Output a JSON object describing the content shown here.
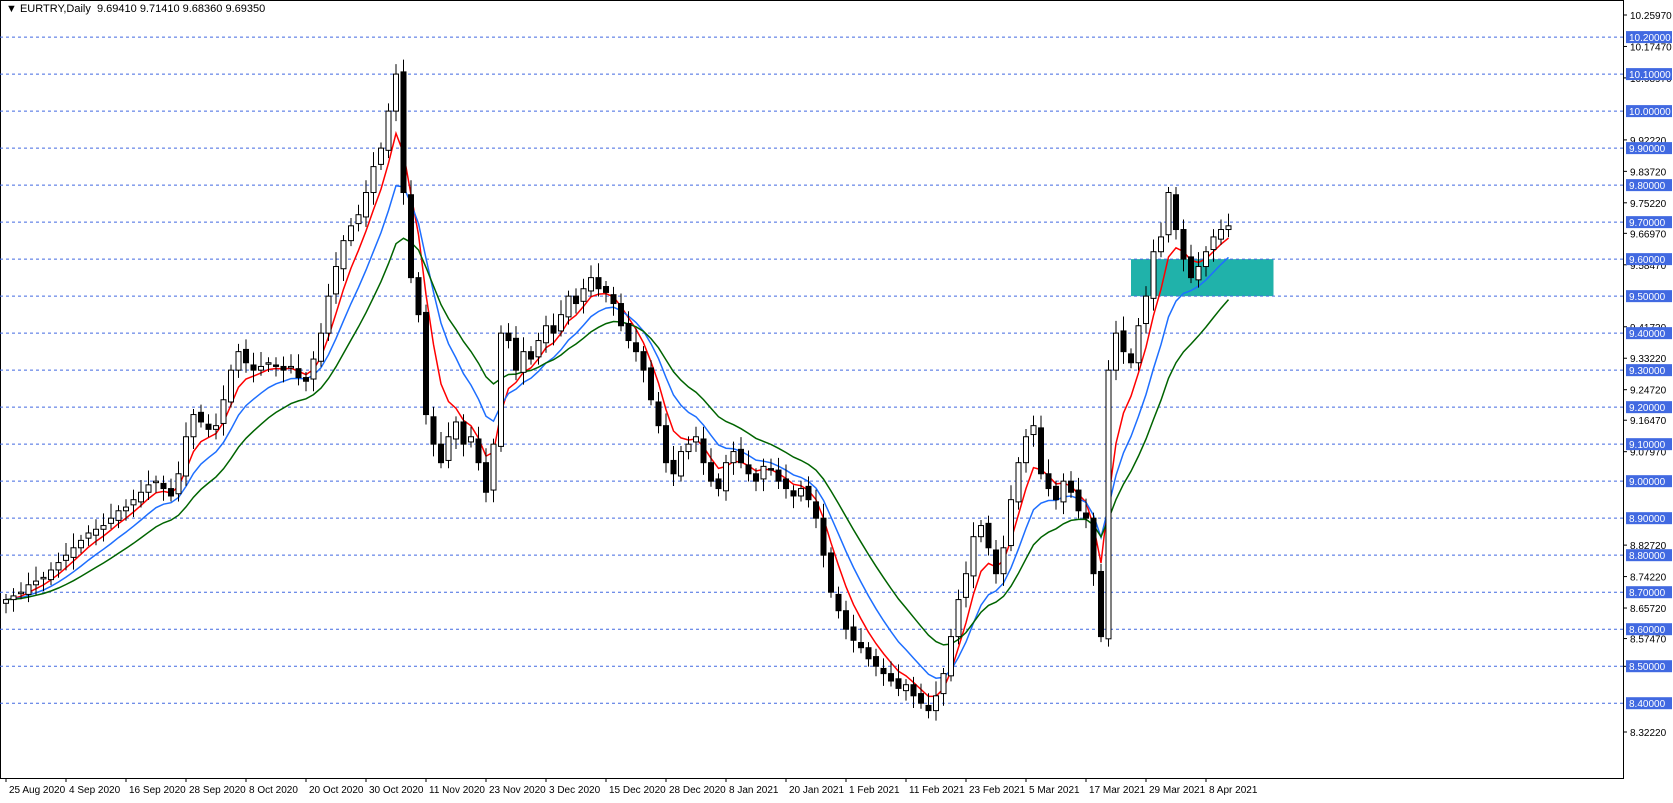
{
  "header": {
    "marker": "▼",
    "symbol": "EURTRY,Daily",
    "ohlc": "9.69410 9.71410 9.68360 9.69350"
  },
  "chart_data": {
    "type": "candlestick",
    "symbol": "EURTRY",
    "timeframe": "Daily",
    "ylim": [
      8.3222,
      10.2597
    ],
    "price_axis_ticks": [
      "10.25970",
      "10.17470",
      "10.08970",
      "9.92220",
      "9.83720",
      "9.75220",
      "9.66970",
      "9.58470",
      "9.41720",
      "9.33220",
      "9.24720",
      "9.16470",
      "9.07970",
      "8.82720",
      "8.74220",
      "8.65720",
      "8.57470",
      "8.49970",
      "8.32220"
    ],
    "grid_levels": [
      10.2,
      10.1,
      10.0,
      9.9,
      9.8,
      9.7,
      9.6,
      9.5,
      9.4,
      9.3,
      9.2,
      9.1,
      9.0,
      8.9,
      8.8,
      8.7,
      8.6,
      8.5,
      8.4
    ],
    "level_labels": [
      "10.20000",
      "10.10000",
      "10.00000",
      "9.90000",
      "9.80000",
      "9.70000",
      "9.60000",
      "9.50000",
      "9.40000",
      "9.30000",
      "9.20000",
      "9.10000",
      "9.00000",
      "8.90000",
      "8.80000",
      "8.70000",
      "8.60000",
      "8.50000",
      "8.40000"
    ],
    "date_labels": [
      "25 Aug 2020",
      "4 Sep 2020",
      "16 Sep 2020",
      "28 Sep 2020",
      "8 Oct 2020",
      "20 Oct 2020",
      "30 Oct 2020",
      "11 Nov 2020",
      "23 Nov 2020",
      "3 Dec 2020",
      "15 Dec 2020",
      "28 Dec 2020",
      "8 Jan 2021",
      "20 Jan 2021",
      "1 Feb 2021",
      "11 Feb 2021",
      "23 Feb 2021",
      "5 Mar 2021",
      "17 Mar 2021",
      "29 Mar 2021",
      "8 Apr 2021"
    ],
    "date_label_bar_index": [
      0,
      8,
      16,
      24,
      32,
      40,
      48,
      56,
      64,
      72,
      80,
      88,
      96,
      104,
      112,
      120,
      128,
      136,
      144,
      152,
      160
    ],
    "zone": {
      "from": 9.5,
      "to": 9.6,
      "start_bar": 150,
      "end_bar": 169,
      "color": "#20b2aa"
    },
    "closes": [
      8.68,
      8.69,
      8.7,
      8.72,
      8.73,
      8.74,
      8.76,
      8.78,
      8.8,
      8.82,
      8.84,
      8.86,
      8.87,
      8.88,
      8.9,
      8.92,
      8.93,
      8.95,
      8.97,
      8.99,
      9.0,
      8.98,
      8.96,
      9.02,
      9.12,
      9.18,
      9.16,
      9.14,
      9.15,
      9.22,
      9.3,
      9.35,
      9.32,
      9.3,
      9.31,
      9.32,
      9.31,
      9.3,
      9.31,
      9.28,
      9.27,
      9.33,
      9.4,
      9.5,
      9.58,
      9.65,
      9.69,
      9.72,
      9.78,
      9.85,
      9.9,
      10.0,
      10.1,
      9.78,
      9.55,
      9.45,
      9.18,
      9.1,
      9.05,
      9.12,
      9.16,
      9.1,
      9.12,
      9.05,
      8.97,
      9.1,
      9.4,
      9.38,
      9.3,
      9.35,
      9.33,
      9.38,
      9.42,
      9.4,
      9.45,
      9.5,
      9.48,
      9.52,
      9.55,
      9.52,
      9.51,
      9.48,
      9.42,
      9.38,
      9.35,
      9.3,
      9.22,
      9.15,
      9.05,
      9.02,
      9.08,
      9.1,
      9.12,
      9.05,
      9.0,
      8.98,
      9.05,
      9.08,
      9.05,
      9.02,
      9.0,
      9.04,
      9.03,
      9.0,
      8.98,
      8.96,
      8.98,
      8.95,
      8.9,
      8.8,
      8.7,
      8.65,
      8.6,
      8.57,
      8.55,
      8.52,
      8.5,
      8.48,
      8.46,
      8.44,
      8.45,
      8.42,
      8.4,
      8.38,
      8.42,
      8.48,
      8.58,
      8.68,
      8.75,
      8.85,
      8.88,
      8.82,
      8.75,
      8.82,
      8.95,
      9.05,
      9.12,
      9.15,
      9.02,
      8.98,
      8.95,
      9.0,
      8.97,
      8.92,
      8.9,
      8.75,
      8.58,
      9.3,
      9.4,
      9.35,
      9.32,
      9.42,
      9.5,
      9.62,
      9.66,
      9.78,
      9.68,
      9.6,
      9.55,
      9.58,
      9.62,
      9.66,
      9.68,
      9.69
    ],
    "ma_red_label": "fast moving average",
    "ma_blue_label": "medium moving average",
    "ma_green_label": "slow moving average"
  }
}
